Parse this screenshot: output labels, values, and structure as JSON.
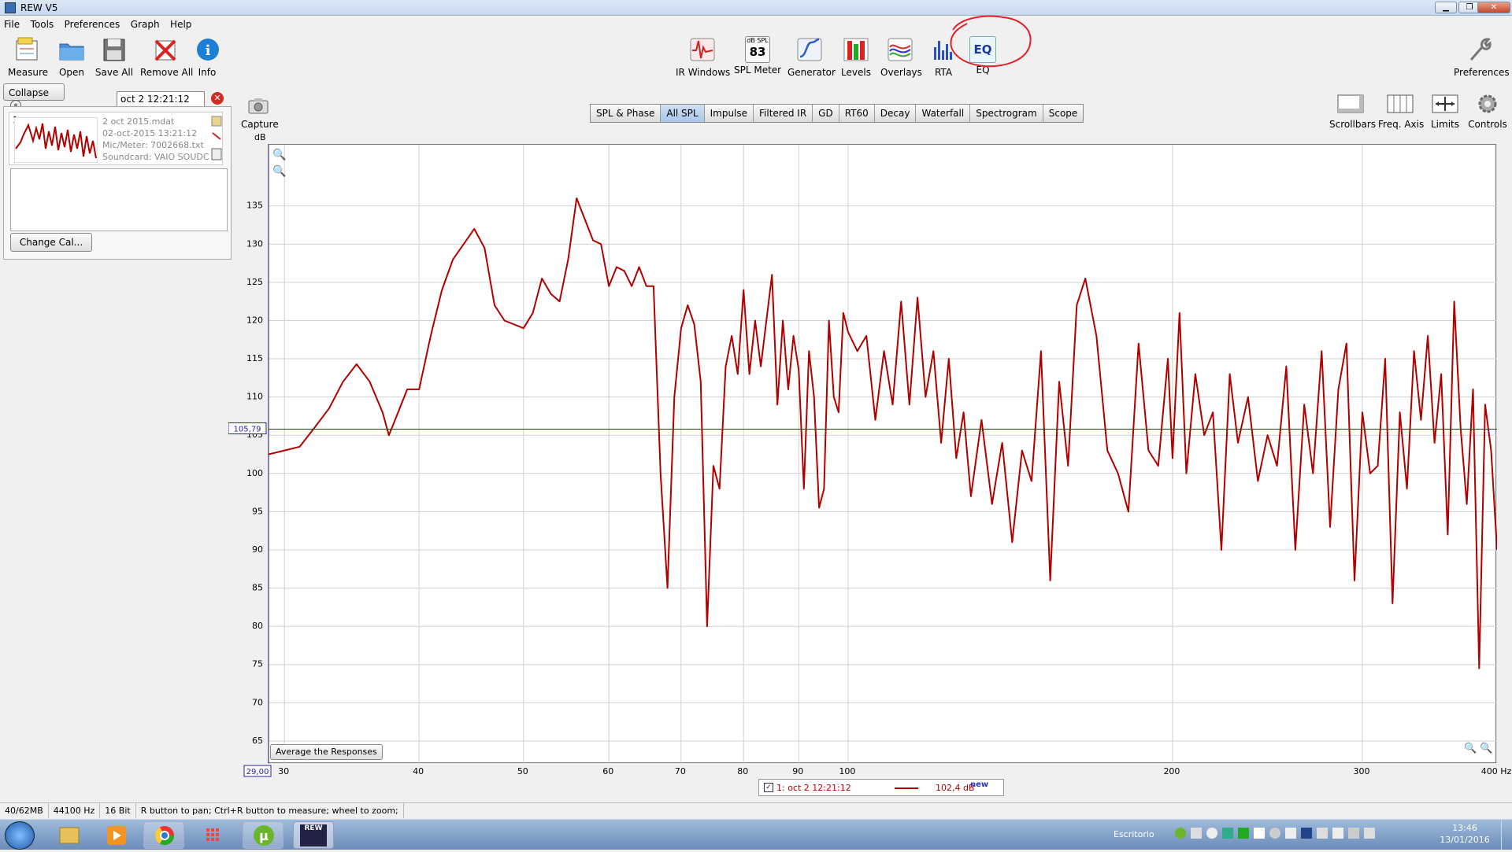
{
  "window": {
    "title": "REW V5",
    "min": "▁",
    "max": "❐",
    "close": "✕"
  },
  "menu": [
    "File",
    "Tools",
    "Preferences",
    "Graph",
    "Help"
  ],
  "toolbar_left": [
    {
      "label": "Measure",
      "icon": "measure-icon"
    },
    {
      "label": "Open",
      "icon": "folder-icon"
    },
    {
      "label": "Save All",
      "icon": "save-icon"
    },
    {
      "label": "Remove All",
      "icon": "remove-icon"
    },
    {
      "label": "Info",
      "icon": "info-icon"
    }
  ],
  "toolbar_center": [
    {
      "label": "IR Windows",
      "icon": "ir-windows-icon"
    },
    {
      "label": "SPL Meter",
      "icon": "spl-meter-icon",
      "top_text": "dB SPL",
      "value": "83"
    },
    {
      "label": "Generator",
      "icon": "generator-icon"
    },
    {
      "label": "Levels",
      "icon": "levels-icon"
    },
    {
      "label": "Overlays",
      "icon": "overlays-icon"
    },
    {
      "label": "RTA",
      "icon": "rta-icon"
    },
    {
      "label": "EQ",
      "icon": "eq-icon",
      "icon_text": "EQ"
    }
  ],
  "toolbar_right": {
    "label": "Preferences",
    "icon": "wrench-icon"
  },
  "graph_tools": [
    {
      "label": "Scrollbars",
      "icon": "scrollbars-icon"
    },
    {
      "label": "Freq. Axis",
      "icon": "freq-axis-icon"
    },
    {
      "label": "Limits",
      "icon": "limits-icon"
    },
    {
      "label": "Controls",
      "icon": "gear-icon"
    }
  ],
  "capture": {
    "label": "Capture",
    "unit": "dB"
  },
  "tabs": [
    {
      "label": "SPL & Phase",
      "active": false
    },
    {
      "label": "All SPL",
      "active": true
    },
    {
      "label": "Impulse",
      "active": false
    },
    {
      "label": "Filtered IR",
      "active": false
    },
    {
      "label": "GD",
      "active": false
    },
    {
      "label": "RT60",
      "active": false
    },
    {
      "label": "Decay",
      "active": false
    },
    {
      "label": "Waterfall",
      "active": false
    },
    {
      "label": "Spectrogram",
      "active": false
    },
    {
      "label": "Scope",
      "active": false
    }
  ],
  "left_panel": {
    "collapse_label": "Collapse",
    "measurement_name": "oct 2 12:21:12",
    "item_number": "1",
    "file": "2 oct 2015.mdat",
    "date": "02-oct-2015 13:21:12",
    "mic": "Mic/Meter: 7002668.txt",
    "soundcard": "Soundcard: VAIO SOUDC",
    "change_cal": "Change Cal..."
  },
  "average_button": "Average the Responses",
  "cursor_y_label": "105,79",
  "cursor_x_label": "29,00",
  "legend": {
    "name": "1: oct 2 12:21:12",
    "value": "102,4 dB",
    "badge": "new"
  },
  "status": {
    "memory": "40/62MB",
    "rate": "44100 Hz",
    "bits": "16 Bit",
    "hint": "R button to pan; Ctrl+R button to measure; wheel to zoom;"
  },
  "taskbar": {
    "desktop": "Escritorio",
    "time": "13:46",
    "date": "13/01/2016",
    "rew_label": "REW"
  },
  "colors": {
    "trace": "#b00000",
    "cursor": "#2323a8",
    "grid": "#d0d0d0",
    "eq_highlight": "#e0202a"
  },
  "chart_data": {
    "type": "line",
    "title": "",
    "xlabel": "",
    "ylabel": "dB",
    "x_scale": "log",
    "x_unit": "Hz",
    "xlim": [
      29,
      400
    ],
    "ylim": [
      62,
      143
    ],
    "x_ticks": [
      30,
      40,
      50,
      60,
      70,
      80,
      90,
      100,
      200,
      300,
      400
    ],
    "x_tick_labels": [
      "30",
      "40",
      "50",
      "60",
      "70",
      "80",
      "90",
      "100",
      "200",
      "300",
      "400 Hz"
    ],
    "y_ticks": [
      65,
      70,
      75,
      80,
      85,
      90,
      95,
      100,
      105,
      110,
      115,
      120,
      125,
      130,
      135
    ],
    "cursor": {
      "y": 105.79,
      "x": 29.0
    },
    "series": [
      {
        "name": "1: oct 2 12:21:12",
        "x": [
          29,
          30,
          31,
          32,
          33,
          34,
          35,
          36,
          37,
          37.5,
          38,
          39,
          40,
          41,
          42,
          43,
          44,
          45,
          46,
          47,
          48,
          50,
          51,
          52,
          53,
          54,
          55,
          56,
          58,
          59,
          60,
          61,
          62,
          63,
          64,
          65,
          66,
          67,
          68,
          69,
          70,
          71,
          72,
          73,
          74,
          75,
          76,
          77,
          78,
          79,
          80,
          81,
          82,
          83,
          85,
          86,
          87,
          88,
          89,
          90,
          91,
          92,
          93,
          94,
          95,
          96,
          97,
          98,
          99,
          100,
          102,
          104,
          106,
          108,
          110,
          112,
          114,
          116,
          118,
          120,
          122,
          124,
          126,
          128,
          130,
          133,
          136,
          139,
          142,
          145,
          148,
          151,
          154,
          157,
          160,
          163,
          166,
          170,
          174,
          178,
          182,
          186,
          190,
          194,
          198,
          200,
          203,
          206,
          210,
          214,
          218,
          222,
          226,
          230,
          235,
          240,
          245,
          250,
          255,
          260,
          265,
          270,
          275,
          280,
          285,
          290,
          295,
          300,
          305,
          310,
          315,
          320,
          325,
          330,
          335,
          340,
          345,
          350,
          355,
          360,
          365,
          370,
          375,
          380,
          385,
          390,
          395,
          400
        ],
        "values": [
          102.5,
          103,
          103.5,
          106,
          108.5,
          112,
          114.3,
          112,
          108,
          105,
          107,
          111,
          111,
          118,
          124,
          128,
          130,
          132,
          129.5,
          122,
          120,
          119,
          121,
          125.5,
          123.5,
          122.5,
          128,
          136,
          130.5,
          130,
          124.5,
          127,
          126.5,
          124.5,
          127,
          124.5,
          124.5,
          100,
          85,
          110,
          119,
          122,
          119.5,
          112,
          80,
          101,
          98,
          114,
          118,
          113,
          124,
          113,
          120,
          114,
          126,
          109,
          120,
          111,
          118,
          113.5,
          98,
          116,
          110,
          95.5,
          98,
          120,
          110,
          108,
          121,
          118.5,
          116,
          118,
          107,
          116,
          109,
          122.5,
          109,
          123,
          110,
          116,
          104,
          115,
          102,
          108,
          97,
          107,
          96,
          104,
          91,
          103,
          99,
          116,
          86,
          112,
          101,
          122,
          125.5,
          118,
          103,
          100,
          95,
          117,
          103,
          101,
          115,
          102,
          121,
          100,
          113,
          105,
          108,
          90,
          113,
          104,
          110,
          99,
          105,
          101,
          114,
          90,
          109,
          100,
          116,
          93,
          111,
          117,
          86,
          108,
          100,
          101,
          115,
          83,
          108,
          98,
          116,
          107,
          118,
          104,
          113,
          92,
          122.5,
          106,
          96,
          111,
          74.5,
          109,
          103,
          90
        ],
        "color": "#b00000"
      }
    ]
  }
}
